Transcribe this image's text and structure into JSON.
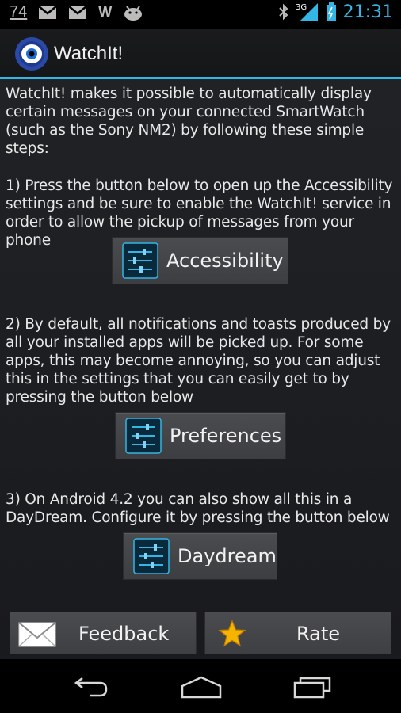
{
  "status_bar": {
    "notification_count": "74",
    "notif_letter": "W",
    "network": "3G",
    "time": "21:31"
  },
  "action_bar": {
    "title": "WatchIt!"
  },
  "intro": {
    "text": "WatchIt! makes it possible to automatically display certain messages on your connected SmartWatch (such as the Sony NM2) by following these simple steps:"
  },
  "step1": {
    "text": "1) Press the button below to open up the Accessibility settings and be sure to enable the WatchIt! service in order to allow the pickup of messages from your phone",
    "button_label": "Accessibility"
  },
  "step2": {
    "text": "2) By default, all notifications and toasts produced by all your installed apps will be picked up. For some apps, this may become annoying, so you can adjust this in the settings that you can easily get to by pressing the button below",
    "button_label": "Preferences"
  },
  "step3": {
    "text": "3) On Android 4.2 you can also show all this in a DayDream. Configure it by pressing the button below",
    "button_label": "Daydream"
  },
  "bottom_buttons": {
    "feedback_label": "Feedback",
    "rate_label": "Rate"
  },
  "icons": {
    "settings": "settings-sliders-icon",
    "feedback": "envelope-icon",
    "rate": "star-icon",
    "back": "back-icon",
    "home": "home-icon",
    "recents": "recent-apps-icon"
  },
  "colors": {
    "accent": "#33b5e5",
    "button": "#44464a",
    "star": "#f5b400"
  }
}
